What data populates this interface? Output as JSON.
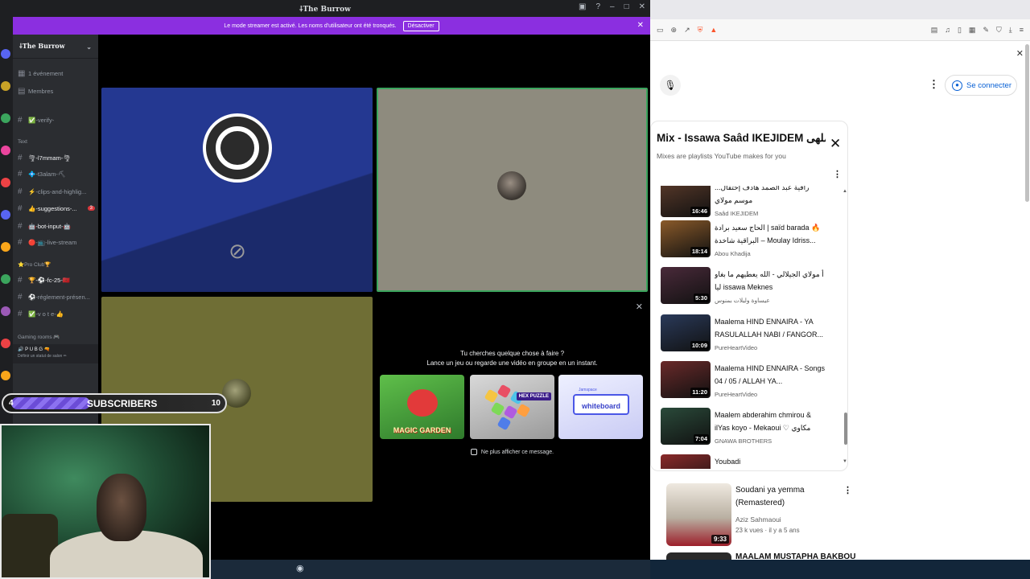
{
  "discord": {
    "window_title": "⸸The Burrow",
    "server_name": "⸸The Burrow",
    "streamer_banner": {
      "text": "Le mode streamer est activé. Les noms d'utilisateur ont été tronqués.",
      "button": "Désactiver"
    },
    "channels": {
      "events": "1 événement",
      "members": "Membres",
      "verify": "✅-verify-",
      "cat_text": "Text",
      "tmmam": "🌪-l7mmam-🌪",
      "t3alam": "💠-t3alam-⛏",
      "clips": "⚡-clips-and-highlig...",
      "suggestions": "👍-suggestions-...",
      "suggestions_badge": "3",
      "bot_input": "🤖-bot-input-🤖",
      "live_stream": "🔴-📺-live-stream",
      "cat_proclub": "⭐Pro Club🏆",
      "fc25": "🏆-⚽-fc-25-🇲🇦",
      "reglement": "⚽-réglement-présen...",
      "vote": "✅-v o t e-👍",
      "cat_gaming": "Gaming rooms 🎮",
      "pubg": "🔊 P U B G 🔫"
    },
    "user_panel": {
      "status": "Définir un statut de salon ✏"
    },
    "activity": {
      "question_line1": "Tu cherches quelque chose à faire ?",
      "question_line2": "Lance un jeu ou regarde une vidéo en groupe en un instant.",
      "card1": "MAGIC GARDEN",
      "card2_tag": "HEX PUZZLE",
      "card3_small": "Jamspace",
      "card3": "whiteboard",
      "checkbox_label": "Ne plus afficher ce message."
    }
  },
  "overlay": {
    "subs_left": "4",
    "subs_label": "SUBSCRIBERS",
    "subs_right": "10",
    "subs_progress": 0.35
  },
  "youtube": {
    "sign_in": "Se connecter",
    "mix": {
      "title": "Mix - Issawa Saâd IKEJIDEM نا ملهى...",
      "subtitle": "Mixes are playlists YouTube makes for you",
      "items": [
        {
          "title": "...راقية عبد الصمد هادف إحتفال موسم مولاي",
          "channel": "Saâd IKEJIDEM",
          "duration": "16:46"
        },
        {
          "title": "الحاج سعيد برادة | saïd barada 🔥 البراقية شاخدة – Moulay Idriss...",
          "channel": "Abou Khadija",
          "duration": "18:14"
        },
        {
          "title": "أ مولاي الجيلالي - الله يعطيهم ما بغاو ليا issawa Meknes",
          "channel": "عيساوة وليلات بمنوس",
          "duration": "5:30"
        },
        {
          "title": "Maalema HIND ENNAIRA - YA RASULALLAH NABI / FANGOR...",
          "channel": "PureHeartVideo",
          "duration": "10:09"
        },
        {
          "title": "Maalema HIND ENNAIRA - Songs 04 / 05 / ALLAH YA...",
          "channel": "PureHeartVideo",
          "duration": "11:20"
        },
        {
          "title": "Maalem abderahim chmirou & ilYas koyo - Mekaoui ♡ مكاوي",
          "channel": "GNAWA BROTHERS",
          "duration": "7:04"
        },
        {
          "title": "Youbadi",
          "channel": "",
          "duration": ""
        }
      ]
    },
    "recommendation": {
      "title": "Soudani ya yemma (Remastered)",
      "channel": "Aziz Sahmaoui",
      "meta": "23 k vues · il y a 5 ans",
      "duration": "9:33"
    },
    "recommendation2_title": "MAALAM MUSTAPHA BAKBOU"
  },
  "colors": {
    "discord_bg": "#2b2d31",
    "streamer_purple": "#8b2fe0",
    "youtube_link": "#065fd4",
    "speaking_green": "#3ba55d"
  }
}
